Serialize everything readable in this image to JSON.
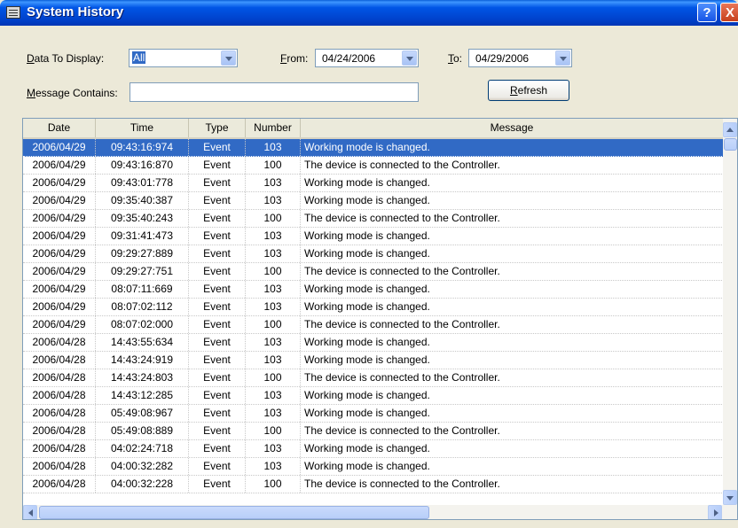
{
  "window": {
    "title": "System History",
    "help_label": "?",
    "close_label": "X"
  },
  "filters": {
    "data_to_display_label": "Data To Display:",
    "data_to_display_value": "All",
    "from_label": "From:",
    "from_value": "04/24/2006",
    "to_label": "To:",
    "to_value": "04/29/2006",
    "message_contains_label": "Message Contains:",
    "message_contains_value": "",
    "refresh_label": "Refresh"
  },
  "table": {
    "columns": [
      "Date",
      "Time",
      "Type",
      "Number",
      "Message"
    ],
    "selected_row": 0,
    "rows": [
      [
        "2006/04/29",
        "09:43:16:974",
        "Event",
        "103",
        "Working mode is changed."
      ],
      [
        "2006/04/29",
        "09:43:16:870",
        "Event",
        "100",
        "The device is connected to the Controller."
      ],
      [
        "2006/04/29",
        "09:43:01:778",
        "Event",
        "103",
        "Working mode is changed."
      ],
      [
        "2006/04/29",
        "09:35:40:387",
        "Event",
        "103",
        "Working mode is changed."
      ],
      [
        "2006/04/29",
        "09:35:40:243",
        "Event",
        "100",
        "The device is connected to the Controller."
      ],
      [
        "2006/04/29",
        "09:31:41:473",
        "Event",
        "103",
        "Working mode is changed."
      ],
      [
        "2006/04/29",
        "09:29:27:889",
        "Event",
        "103",
        "Working mode is changed."
      ],
      [
        "2006/04/29",
        "09:29:27:751",
        "Event",
        "100",
        "The device is connected to the Controller."
      ],
      [
        "2006/04/29",
        "08:07:11:669",
        "Event",
        "103",
        "Working mode is changed."
      ],
      [
        "2006/04/29",
        "08:07:02:112",
        "Event",
        "103",
        "Working mode is changed."
      ],
      [
        "2006/04/29",
        "08:07:02:000",
        "Event",
        "100",
        "The device is connected to the Controller."
      ],
      [
        "2006/04/28",
        "14:43:55:634",
        "Event",
        "103",
        "Working mode is changed."
      ],
      [
        "2006/04/28",
        "14:43:24:919",
        "Event",
        "103",
        "Working mode is changed."
      ],
      [
        "2006/04/28",
        "14:43:24:803",
        "Event",
        "100",
        "The device is connected to the Controller."
      ],
      [
        "2006/04/28",
        "14:43:12:285",
        "Event",
        "103",
        "Working mode is changed."
      ],
      [
        "2006/04/28",
        "05:49:08:967",
        "Event",
        "103",
        "Working mode is changed."
      ],
      [
        "2006/04/28",
        "05:49:08:889",
        "Event",
        "100",
        "The device is connected to the Controller."
      ],
      [
        "2006/04/28",
        "04:02:24:718",
        "Event",
        "103",
        "Working mode is changed."
      ],
      [
        "2006/04/28",
        "04:00:32:282",
        "Event",
        "103",
        "Working mode is changed."
      ],
      [
        "2006/04/28",
        "04:00:32:228",
        "Event",
        "100",
        "The device is connected to the Controller."
      ]
    ]
  },
  "icons": {
    "title": "window-list-icon",
    "help": "help-icon",
    "close": "close-icon",
    "combo_arrow": "chevron-down-icon",
    "scroll": [
      "scroll-up-icon",
      "scroll-down-icon",
      "scroll-left-icon",
      "scroll-right-icon"
    ]
  },
  "colors": {
    "title_bar": "#0054e3",
    "selection": "#316ac5",
    "window_face": "#ece9d8",
    "close_button": "#d4532b"
  }
}
